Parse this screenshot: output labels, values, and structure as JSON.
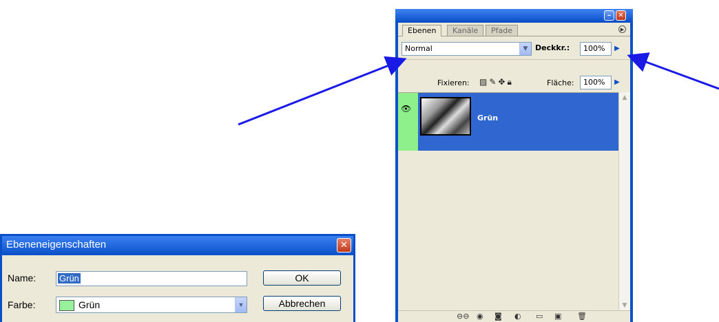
{
  "layers_panel": {
    "tabs": [
      "Ebenen",
      "Kanäle",
      "Pfade"
    ],
    "blend_mode": "Normal",
    "opacity_label": "Deckkr.:",
    "opacity_value": "100%",
    "lock_label": "Fixieren:",
    "fill_label": "Fläche:",
    "fill_value": "100%",
    "layer": {
      "name": "Grün",
      "label_color": "#8ef08a",
      "selected_color": "#2f66cf"
    }
  },
  "dialog": {
    "title": "Ebeneneigenschaften",
    "name_label": "Name:",
    "name_value": "Grün",
    "color_label": "Farbe:",
    "color_value": "Grün",
    "ok_label": "OK",
    "cancel_label": "Abbrechen"
  },
  "annotation_color": "#1a1ae6"
}
